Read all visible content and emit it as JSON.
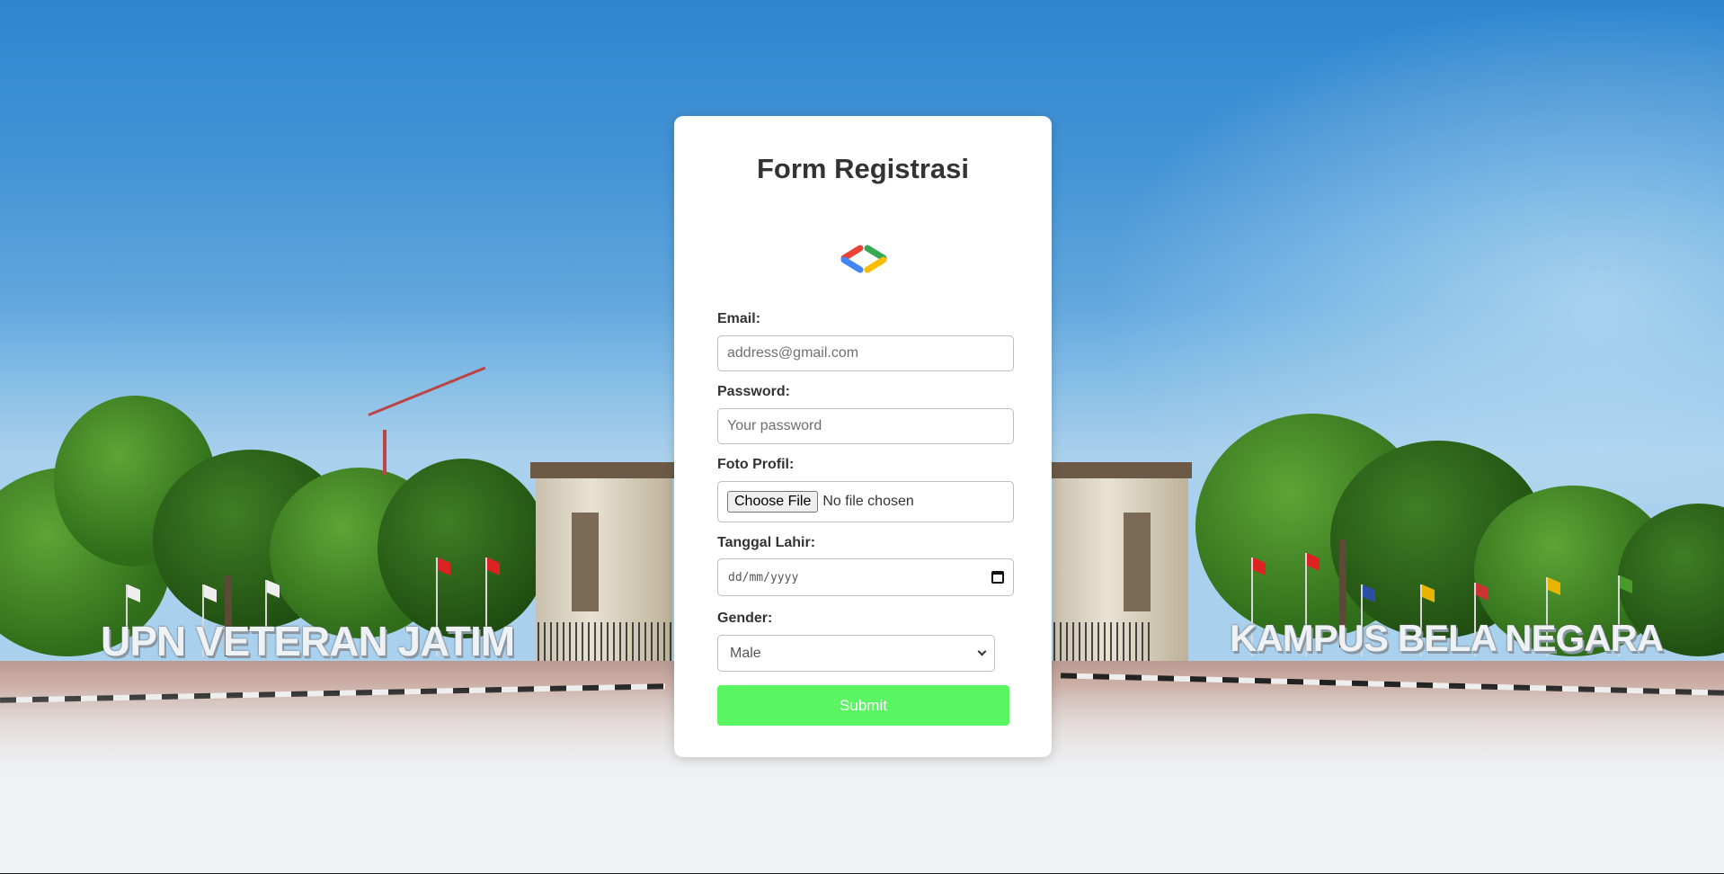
{
  "background": {
    "sign_left": "UPN VETERAN JATIM",
    "sign_right": "KAMPUS BELA NEGARA"
  },
  "form": {
    "title": "Form Registrasi",
    "logo_icon": "code-brackets-icon",
    "email": {
      "label": "Email:",
      "placeholder": "address@gmail.com"
    },
    "password": {
      "label": "Password:",
      "placeholder": "Your password"
    },
    "photo": {
      "label": "Foto Profil:",
      "button": "Choose File",
      "status": "No file chosen"
    },
    "birthdate": {
      "label": "Tanggal Lahir:",
      "placeholder": "dd/mm/yyyy"
    },
    "gender": {
      "label": "Gender:",
      "selected": "Male"
    },
    "submit": "Submit"
  },
  "colors": {
    "submit_bg": "#5af562",
    "logo_blue": "#4285f4",
    "logo_red": "#ea4335",
    "logo_green": "#34a853",
    "logo_yellow": "#fbbc04"
  }
}
